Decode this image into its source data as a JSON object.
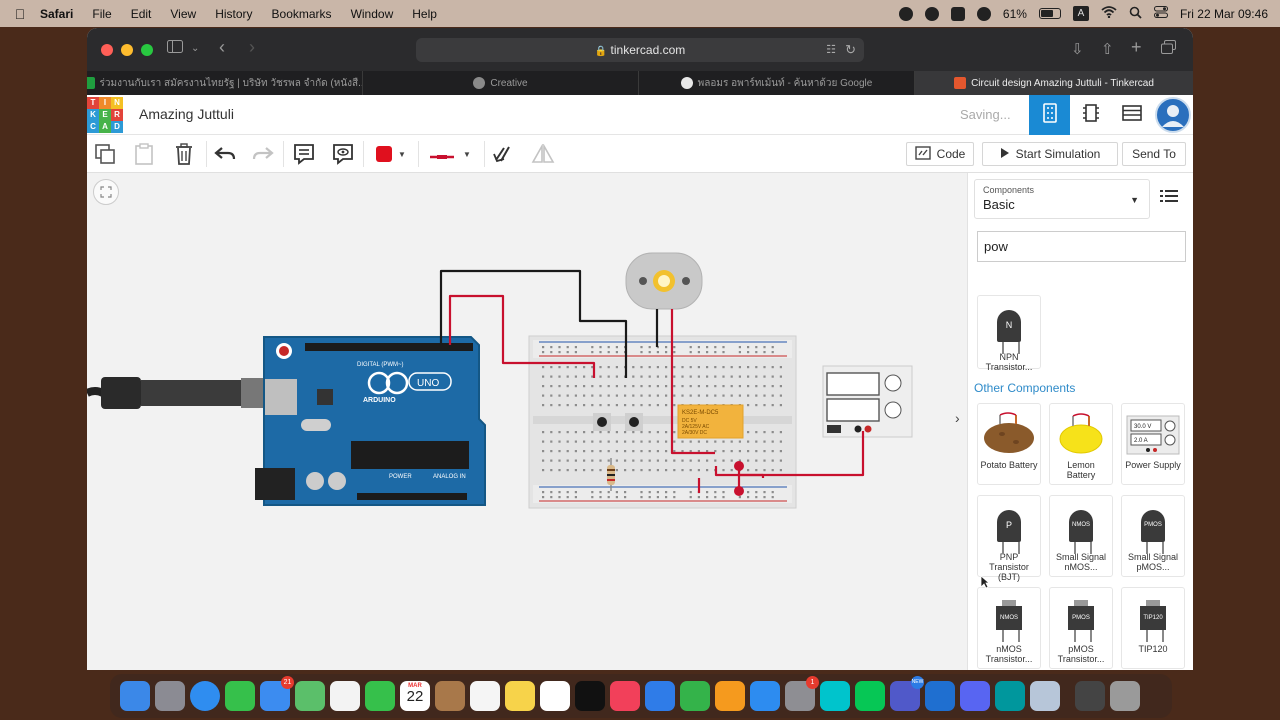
{
  "menubar": {
    "app": "Safari",
    "items": [
      "File",
      "Edit",
      "View",
      "History",
      "Bookmarks",
      "Window",
      "Help"
    ],
    "battery": "61%",
    "input": "A",
    "datetime": "Fri 22 Mar  09:46"
  },
  "browser": {
    "url": "tinkercad.com",
    "tabs": [
      {
        "title": "ร่วมงานกับเรา สมัครงานไทยรัฐ | บริษัท วัชรพล จำกัด (หนังสื...",
        "favicon_color": "#1f9e3f"
      },
      {
        "title": "Creative",
        "favicon_color": "#8a8a8a"
      },
      {
        "title": "พลอมร อพาร์ทเม้นท์ - ค้นหาด้วย Google",
        "favicon_color": "#e8e8e8"
      },
      {
        "title": "Circuit design Amazing Juttuli - Tinkercad",
        "favicon_color": "#e4572e",
        "active": true
      }
    ]
  },
  "tinkercad": {
    "logo": [
      "T",
      "I",
      "N",
      "K",
      "E",
      "R",
      "C",
      "A",
      "D"
    ],
    "design_name": "Amazing Juttuli",
    "status": "Saving...",
    "toolbar": {
      "code_label": "Code",
      "sim_label": "Start Simulation",
      "send_label": "Send To",
      "color_swatch": "#e0101e"
    },
    "circuit": {
      "board_name": "ARDUINO",
      "board_model": "UNO",
      "digital_header": "DIGITAL (PWM~)",
      "power_label": "POWER",
      "analog_label": "ANALOG IN",
      "relay_text": [
        "KS2E-M-DC5",
        "DC 5V",
        "2A/125V AC",
        "2A/30V DC"
      ]
    },
    "panel": {
      "components_label": "Components",
      "components_value": "Basic",
      "search_value": "pow",
      "other_title": "Other Components",
      "search_results": [
        {
          "name": "NPN Transistor...",
          "glyph": "N"
        }
      ],
      "items": [
        {
          "name": "Potato Battery",
          "icon": "potato-icon"
        },
        {
          "name": "Lemon Battery",
          "icon": "lemon-icon"
        },
        {
          "name": "Power Supply",
          "icon": "power-supply-icon",
          "readouts": [
            "30.0 V",
            "2.0 A"
          ]
        },
        {
          "name": "PNP Transistor (BJT)",
          "glyph": "P"
        },
        {
          "name": "Small Signal nMOS...",
          "glyph": "NMOS"
        },
        {
          "name": "Small Signal pMOS...",
          "glyph": "PMOS"
        },
        {
          "name": "nMOS Transistor...",
          "glyph": "NMOS"
        },
        {
          "name": "pMOS Transistor...",
          "glyph": "PMOS"
        },
        {
          "name": "TIP120",
          "glyph": "TIP120"
        }
      ]
    }
  },
  "dock": {
    "mail_badge": "21",
    "calendar_month": "MAR",
    "calendar_day": "22",
    "settings_badge": "1",
    "teams_badge": "NEW"
  }
}
